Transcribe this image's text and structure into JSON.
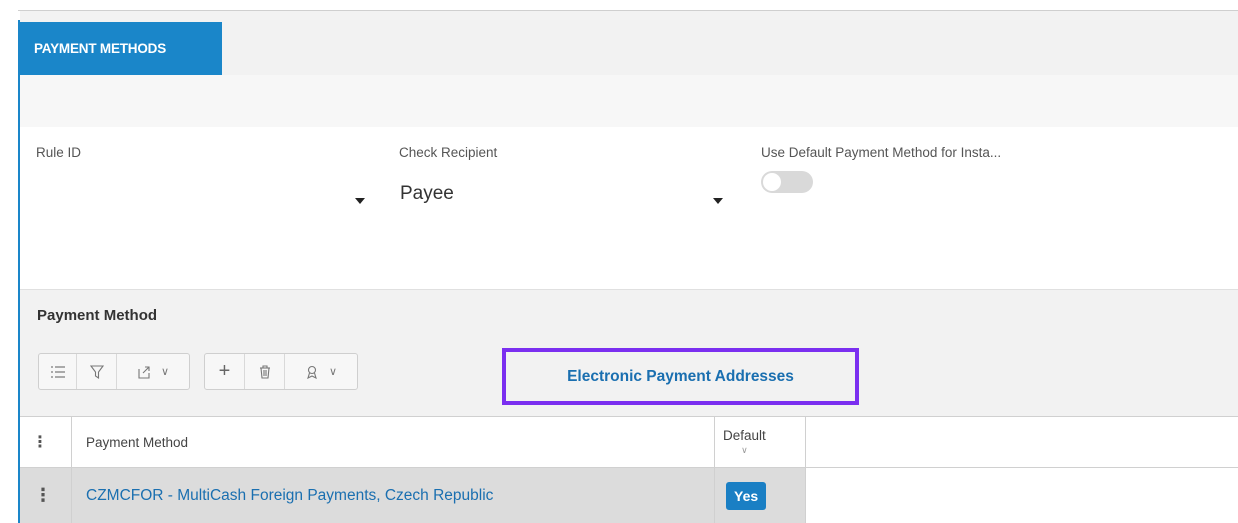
{
  "tab": {
    "label": "PAYMENT METHODS"
  },
  "form": {
    "rule_id": {
      "label": "Rule ID",
      "value": ""
    },
    "check_recipient": {
      "label": "Check Recipient",
      "value": "Payee"
    },
    "use_default": {
      "label": "Use Default Payment Method for Insta...",
      "enabled": false
    }
  },
  "section": {
    "title": "Payment Method",
    "toolbar": {
      "list_icon": "list-icon",
      "filter_icon": "filter-icon",
      "export_icon": "export-icon",
      "add_icon": "plus-icon",
      "delete_icon": "trash-icon",
      "actions_icon": "ribbon-icon"
    },
    "electronic_payment_addresses": "Electronic Payment Addresses"
  },
  "grid": {
    "columns": [
      "Payment Method",
      "Default"
    ],
    "rows": [
      {
        "payment_method": "CZMCFOR - MultiCash Foreign Payments, Czech Republic",
        "default": "Yes"
      }
    ]
  },
  "colors": {
    "accent": "#1a86c9",
    "highlight": "#7b2ff0",
    "link": "#1a6fb0"
  }
}
